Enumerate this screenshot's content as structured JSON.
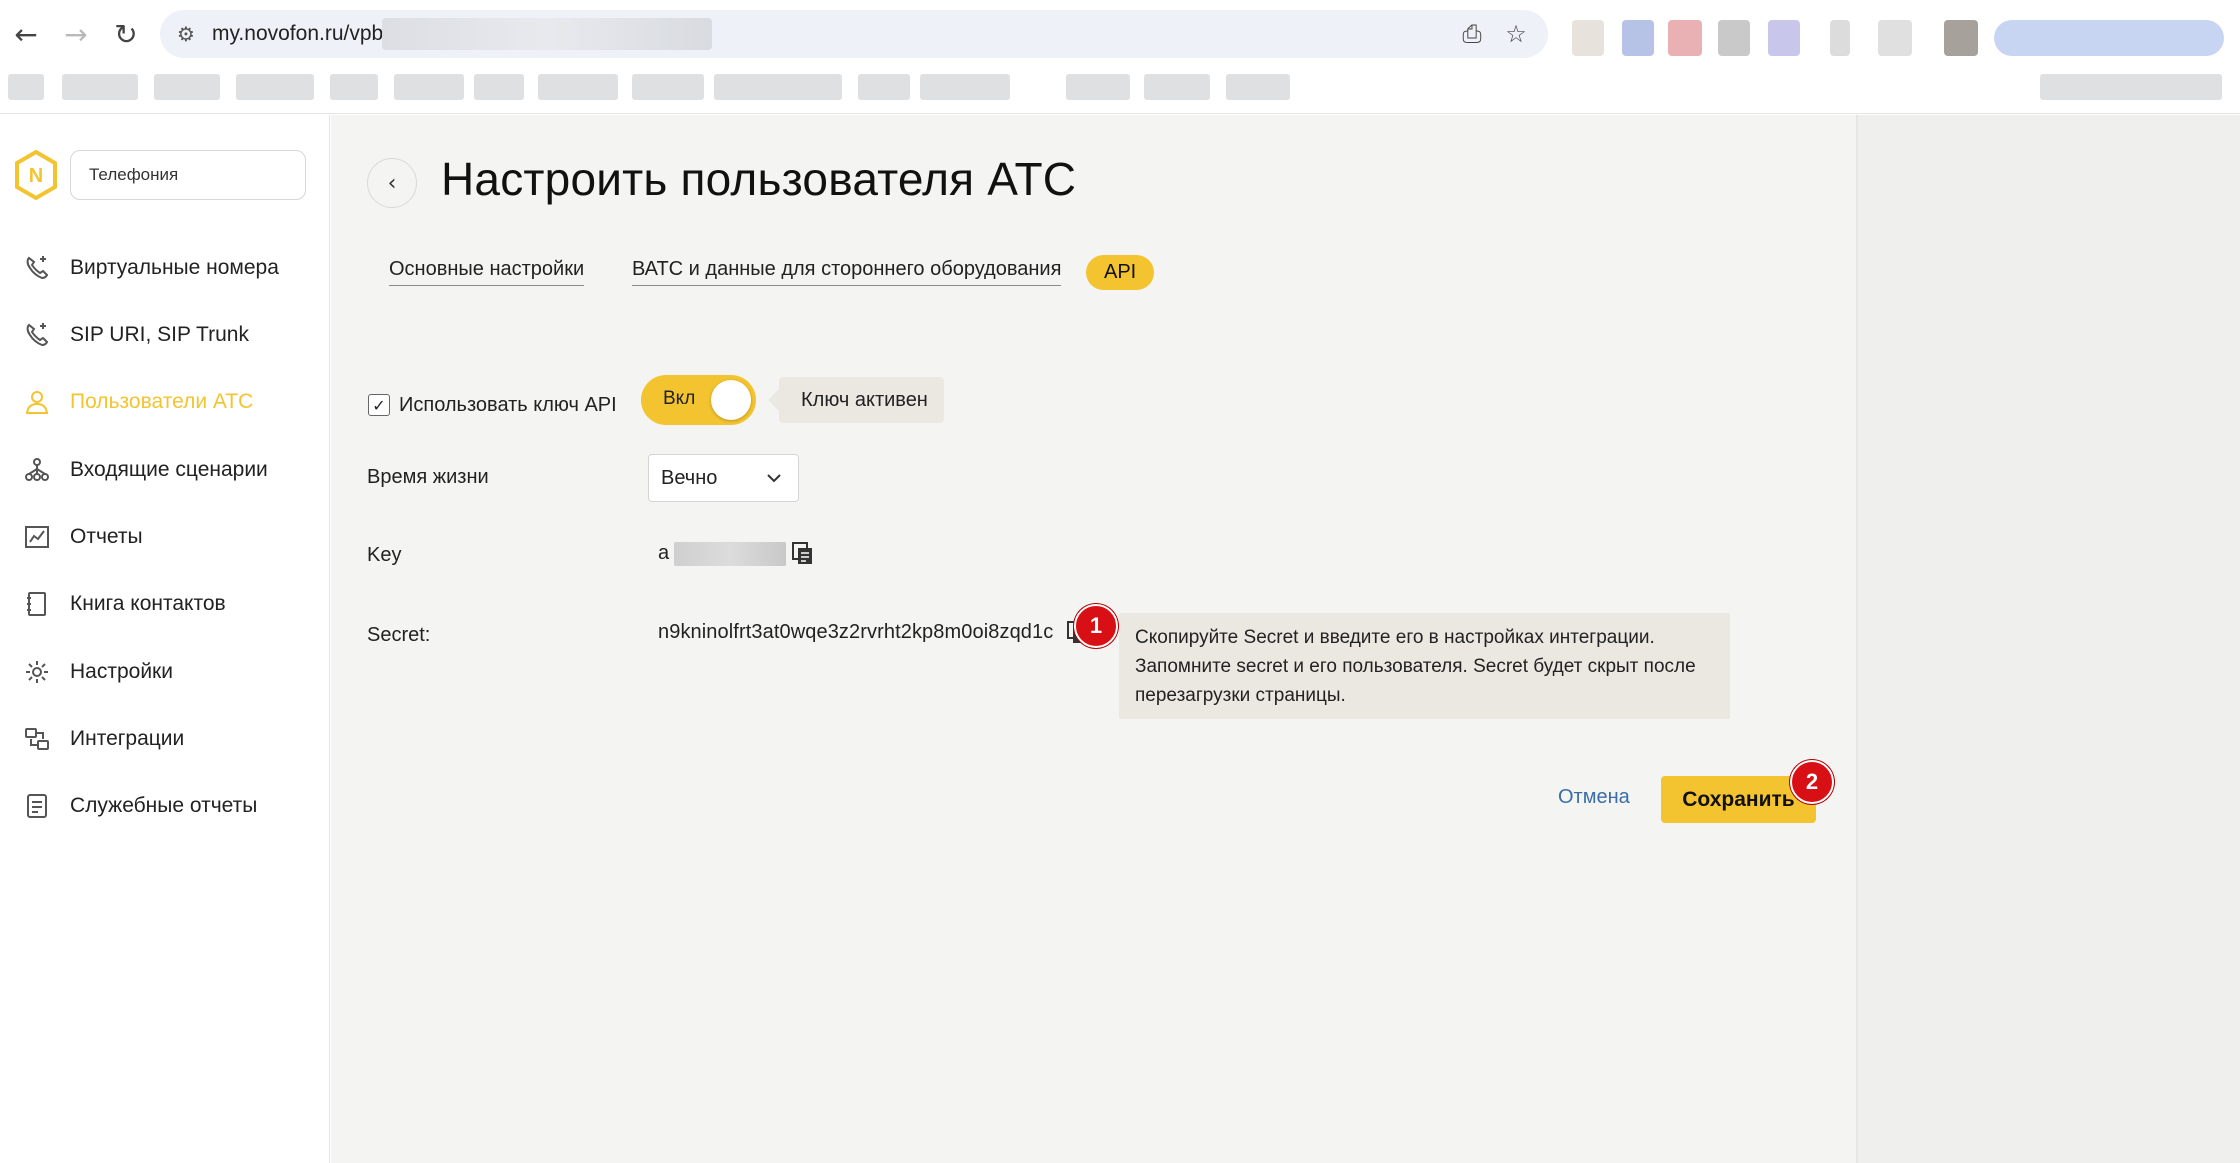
{
  "browser": {
    "url": "my.novofon.ru/vpb",
    "nav": {
      "back": "←",
      "forward": "→",
      "reload": "↻"
    }
  },
  "sidebar": {
    "product": "Телефония",
    "items": [
      {
        "label": "Виртуальные номера",
        "icon": "phone-icon",
        "active": false
      },
      {
        "label": "SIP URI, SIP Trunk",
        "icon": "phone-icon",
        "active": false
      },
      {
        "label": "Пользователи АТС",
        "icon": "user-icon",
        "active": true
      },
      {
        "label": "Входящие сценарии",
        "icon": "flow-icon",
        "active": false
      },
      {
        "label": "Отчеты",
        "icon": "chart-icon",
        "active": false
      },
      {
        "label": "Книга контактов",
        "icon": "book-icon",
        "active": false
      },
      {
        "label": "Настройки",
        "icon": "gear-icon",
        "active": false
      },
      {
        "label": "Интеграции",
        "icon": "integration-icon",
        "active": false
      },
      {
        "label": "Служебные отчеты",
        "icon": "report-icon",
        "active": false
      }
    ]
  },
  "page": {
    "back": "‹",
    "title": "Настроить пользователя АТС",
    "tabs": [
      {
        "label": "Основные настройки",
        "active": false
      },
      {
        "label": "ВАТС и данные для стороннего оборудования",
        "active": false
      },
      {
        "label": "API",
        "active": true
      }
    ]
  },
  "api": {
    "use_key_label": "Использовать ключ API",
    "use_key_checked": true,
    "toggle_label": "Вкл",
    "key_status": "Ключ активен",
    "lifetime_label": "Время жизни",
    "lifetime_value": "Вечно",
    "key_label": "Key",
    "key_value": "a",
    "secret_label": "Secret:",
    "secret_value": "n9kninolfrt3at0wqe3z2rvrht2kp8m0oi8zqd1c",
    "hint": "Скопируйте Secret и введите его в настройках интеграции. Запомните secret и его пользователя. Secret будет скрыт после перезагрузки страницы."
  },
  "actions": {
    "cancel": "Отмена",
    "save": "Сохранить"
  },
  "markers": [
    "1",
    "2"
  ],
  "colors": {
    "accent": "#f4c430",
    "link": "#3a6ea5",
    "marker": "#d90f16",
    "content_bg": "#f4f4f3"
  }
}
